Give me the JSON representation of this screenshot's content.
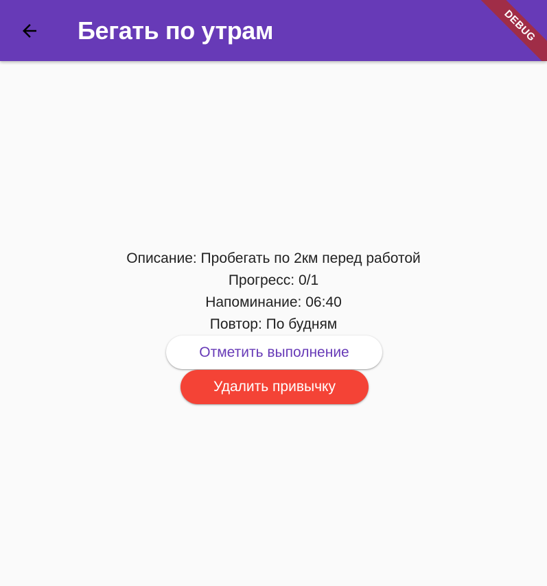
{
  "app_bar": {
    "title": "Бегать по утрам",
    "back_icon": "arrow-back-icon",
    "background_color": "#673ab7"
  },
  "debug_banner": {
    "label": "DEBUG",
    "color": "#a02d47"
  },
  "habit": {
    "description": "Описание: Пробегать по 2км перед работой",
    "progress": "Прогресс: 0/1",
    "reminder": "Напоминание: 06:40",
    "repeat": "Повтор: По будням"
  },
  "actions": {
    "mark_done_label": "Отметить выполнение",
    "delete_label": "Удалить привычку",
    "delete_color": "#f44336"
  }
}
